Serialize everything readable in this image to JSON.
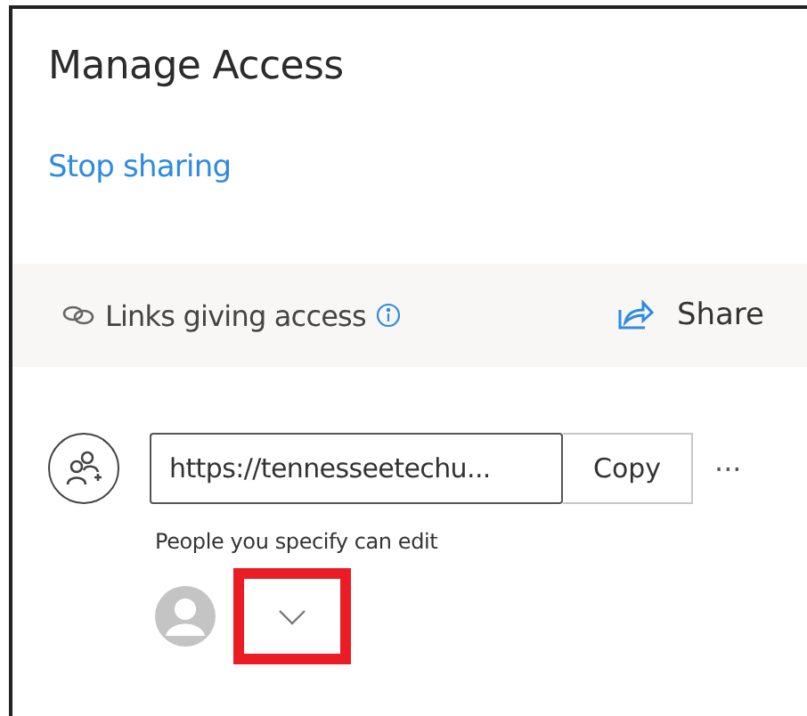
{
  "panel": {
    "title": "Manage Access",
    "stop_sharing_link": "Stop sharing"
  },
  "links_section": {
    "label": "Links giving access",
    "share_button": "Share"
  },
  "link": {
    "url": "https://tennesseetechu...",
    "copy_button": "Copy",
    "more_button": "···",
    "description": "People you specify can edit",
    "expand_button": {
      "highlighted": true
    }
  }
}
